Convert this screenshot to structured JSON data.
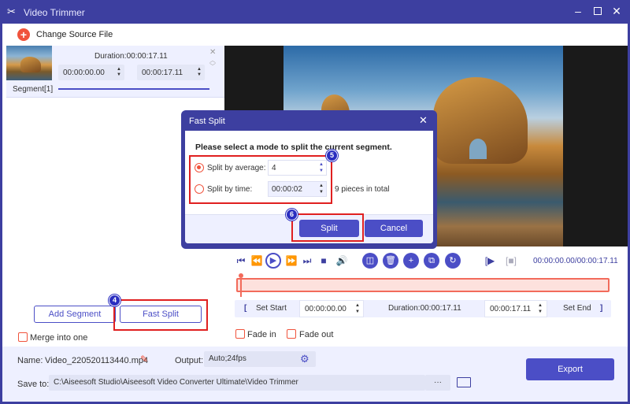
{
  "window": {
    "title": "Video Trimmer",
    "minimize_icon": "minimize-icon",
    "maximize_icon": "maximize-icon",
    "close_icon": "close-icon"
  },
  "toolbar": {
    "change_source_label": "Change Source File"
  },
  "segment": {
    "duration": "Duration:00:00:17.11",
    "start": "00:00:00.00",
    "end": "00:00:17.11",
    "label": "Segment[1]"
  },
  "player": {
    "timecode": "00:00:00.00/00:00:17.11",
    "set_start_label": "Set Start",
    "start_value": "00:00:00.00",
    "duration": "Duration:00:00:17.11",
    "end_value": "00:00:17.11",
    "set_end_label": "Set End",
    "fade_in_label": "Fade in",
    "fade_out_label": "Fade out"
  },
  "left_actions": {
    "add_segment_label": "Add Segment",
    "fast_split_label": "Fast Split",
    "merge_label": "Merge into one"
  },
  "annotations": {
    "step4": "4",
    "step5": "5",
    "step6": "6"
  },
  "dialog": {
    "title": "Fast Split",
    "prompt": "Please select a mode to split the current segment.",
    "by_average_label": "Split by average:",
    "by_average_value": "4",
    "by_time_label": "Split by time:",
    "by_time_value": "00:00:02",
    "pieces_text": "9 pieces in total",
    "split_label": "Split",
    "cancel_label": "Cancel"
  },
  "bottom": {
    "name_label": "Name:",
    "name_value": "Video_220520113440.mp4",
    "output_label": "Output:",
    "output_value": "Auto;24fps",
    "save_label": "Save to:",
    "save_path": "C:\\Aiseesoft Studio\\Aiseesoft Video Converter Ultimate\\Video Trimmer",
    "browse_dots": "···",
    "export_label": "Export"
  },
  "colors": {
    "accent": "#3d3fa0",
    "button": "#4b4ec6",
    "highlight": "#e02020",
    "orange": "#f0533c"
  }
}
